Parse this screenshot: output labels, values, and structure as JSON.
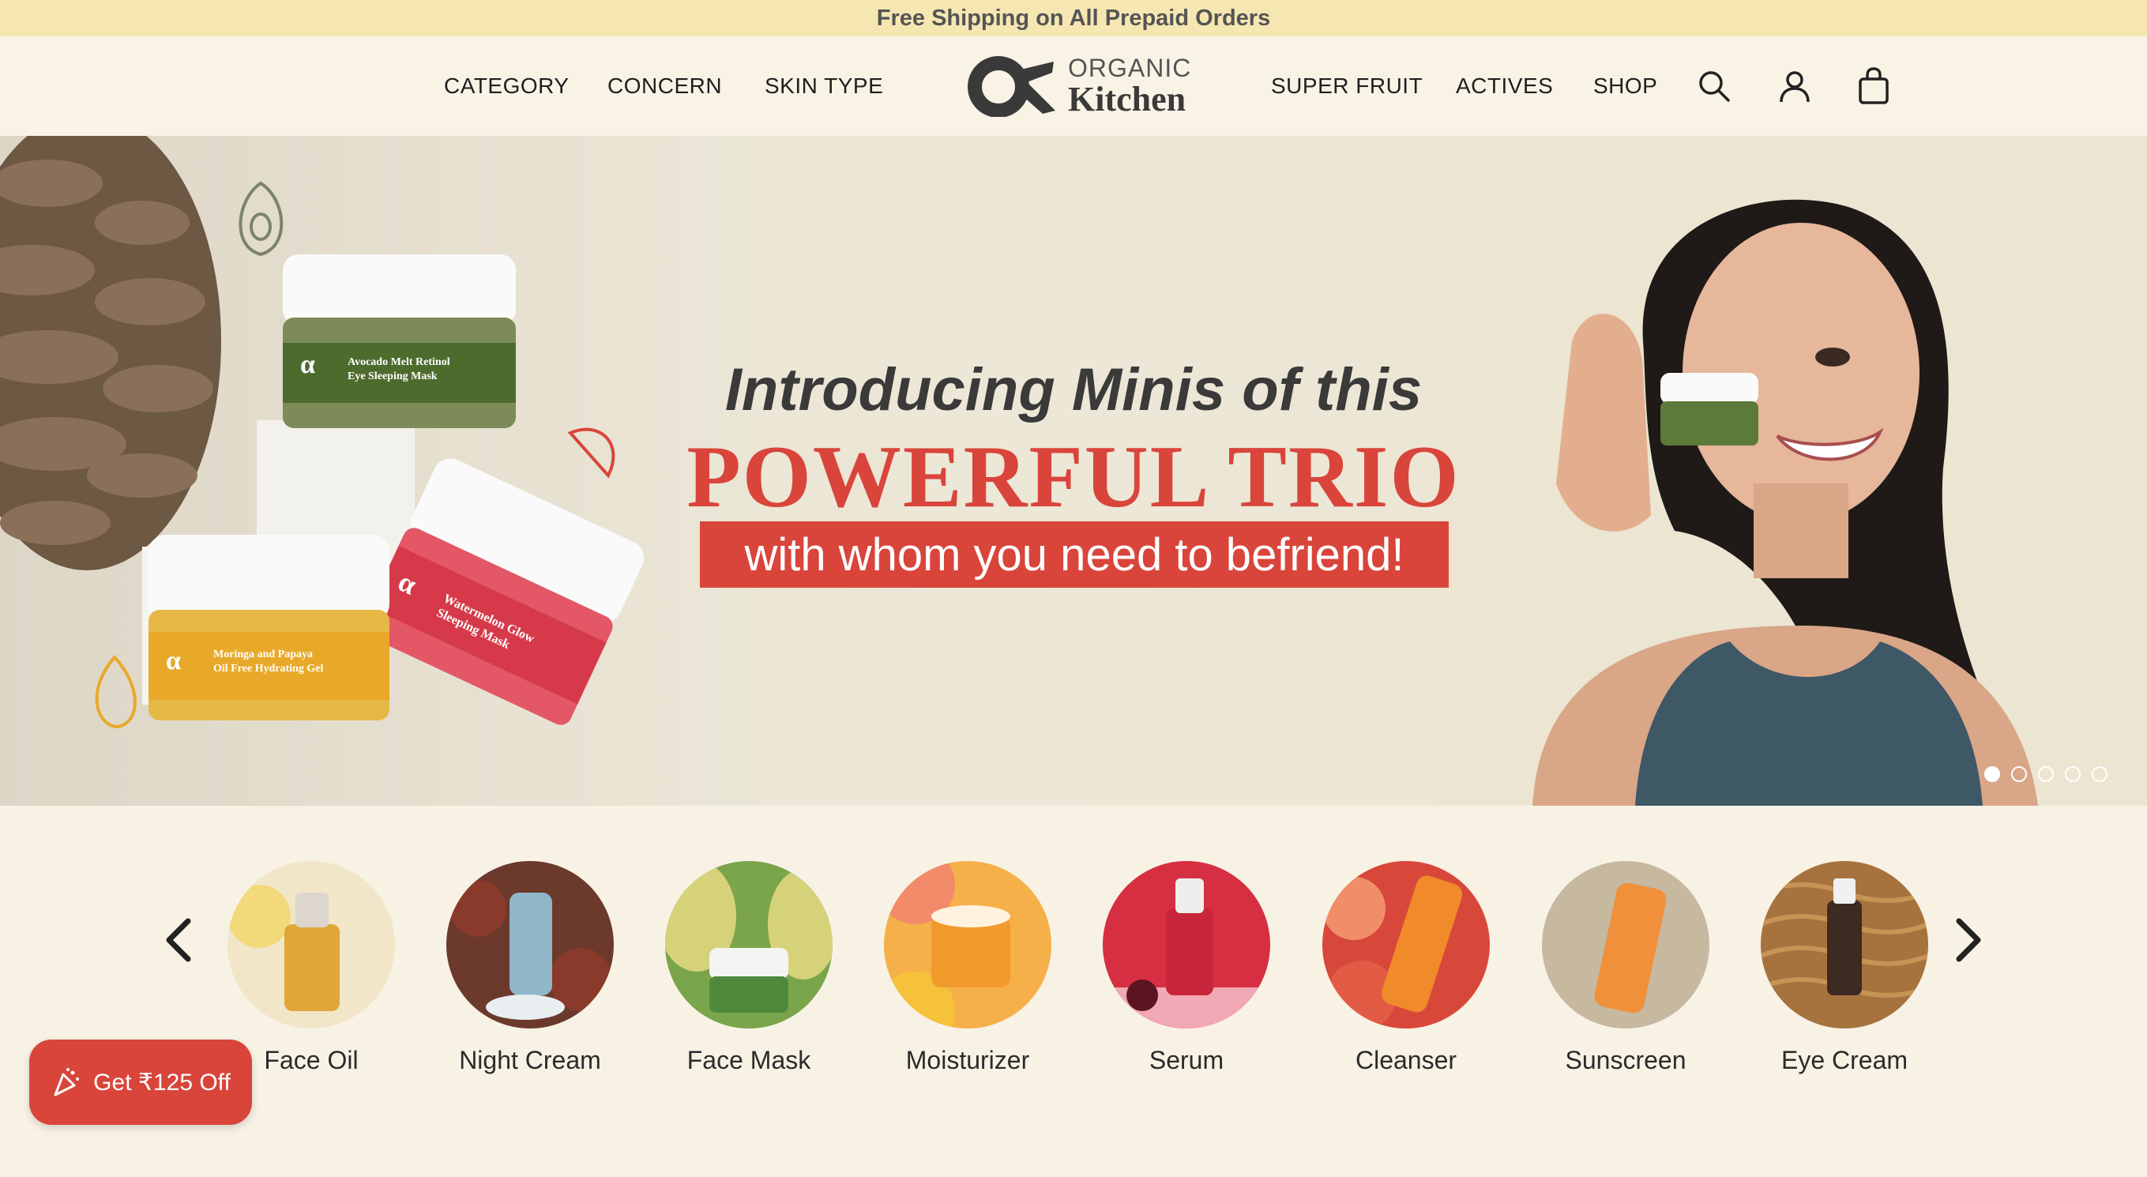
{
  "announcement": {
    "text": "Free Shipping on All Prepaid Orders"
  },
  "nav": {
    "left": [
      "CATEGORY",
      "CONCERN",
      "SKIN TYPE"
    ],
    "right": [
      "SUPER FRUIT",
      "ACTIVES",
      "SHOP"
    ]
  },
  "logo": {
    "top": "ORGANIC",
    "bottom": "Kitchen"
  },
  "icons": {
    "search": "search-icon",
    "account": "user-icon",
    "cart": "shopping-bag-icon"
  },
  "hero": {
    "line1": "Introducing Minis of this",
    "line2": "POWERFUL TRIO",
    "line3": "with whom you need to befriend!",
    "slides": 5,
    "active_slide": 1,
    "jar_labels": {
      "green": "Avocado Melt Retinol Eye Sleeping Mask",
      "red": "Watermelon Glow Sleeping Mask",
      "yellow": "Moringa and Papaya Oil Free Hydrating Gel"
    }
  },
  "categories": [
    {
      "label": "Face Oil",
      "color": "#e0a63a",
      "bg": "#f1e6c8"
    },
    {
      "label": "Night Cream",
      "color": "#8fb6c9",
      "bg": "#6b3a2c"
    },
    {
      "label": "Face Mask",
      "color": "#4f8a3c",
      "bg": "#7aa54a"
    },
    {
      "label": "Moisturizer",
      "color": "#f39a2c",
      "bg": "#f5b04a"
    },
    {
      "label": "Serum",
      "color": "#c8243a",
      "bg": "#d62f42"
    },
    {
      "label": "Cleanser",
      "color": "#f08a2a",
      "bg": "#d8483a"
    },
    {
      "label": "Sunscreen",
      "color": "#f0903a",
      "bg": "#c7b8a0"
    },
    {
      "label": "Eye Cream",
      "color": "#3c2b22",
      "bg": "#a6733e"
    }
  ],
  "coupon": {
    "label": "Get ₹125 Off"
  },
  "colors": {
    "accent": "#d9453b",
    "announcement_bg": "#f6e7b2",
    "page_bg": "#f8f2e5"
  }
}
